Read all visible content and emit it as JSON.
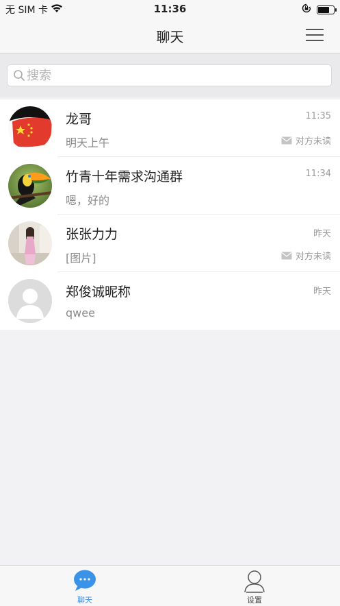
{
  "status_bar": {
    "carrier": "无 SIM 卡",
    "time": "11:36",
    "icons": [
      "wifi-icon",
      "orientation-lock-icon",
      "battery-icon"
    ]
  },
  "nav": {
    "title": "聊天",
    "menu_icon": "hamburger-menu-icon"
  },
  "search": {
    "placeholder": "搜索",
    "icon": "search-icon"
  },
  "chats": [
    {
      "name": "龙哥",
      "message": "明天上午",
      "time": "11:35",
      "status": "对方未读",
      "avatar": "china-flag-avatar"
    },
    {
      "name": "竹青十年需求沟通群",
      "message": "嗯，好的",
      "time": "11:34",
      "status": "",
      "avatar": "toucan-avatar"
    },
    {
      "name": "张张力力",
      "message": "[图片]",
      "time": "昨天",
      "status": "对方未读",
      "avatar": "girl-photo-avatar"
    },
    {
      "name": "郑俊诚昵称",
      "message": "qwee",
      "time": "昨天",
      "status": "",
      "avatar": "default-person-avatar"
    }
  ],
  "tabs": [
    {
      "label": "聊天",
      "icon": "chat-bubble-icon",
      "active": true
    },
    {
      "label": "设置",
      "icon": "person-outline-icon",
      "active": false
    }
  ],
  "colors": {
    "accent": "#3b93e8",
    "background": "#f2f2f4",
    "unread_gray": "#9a9a9a"
  }
}
